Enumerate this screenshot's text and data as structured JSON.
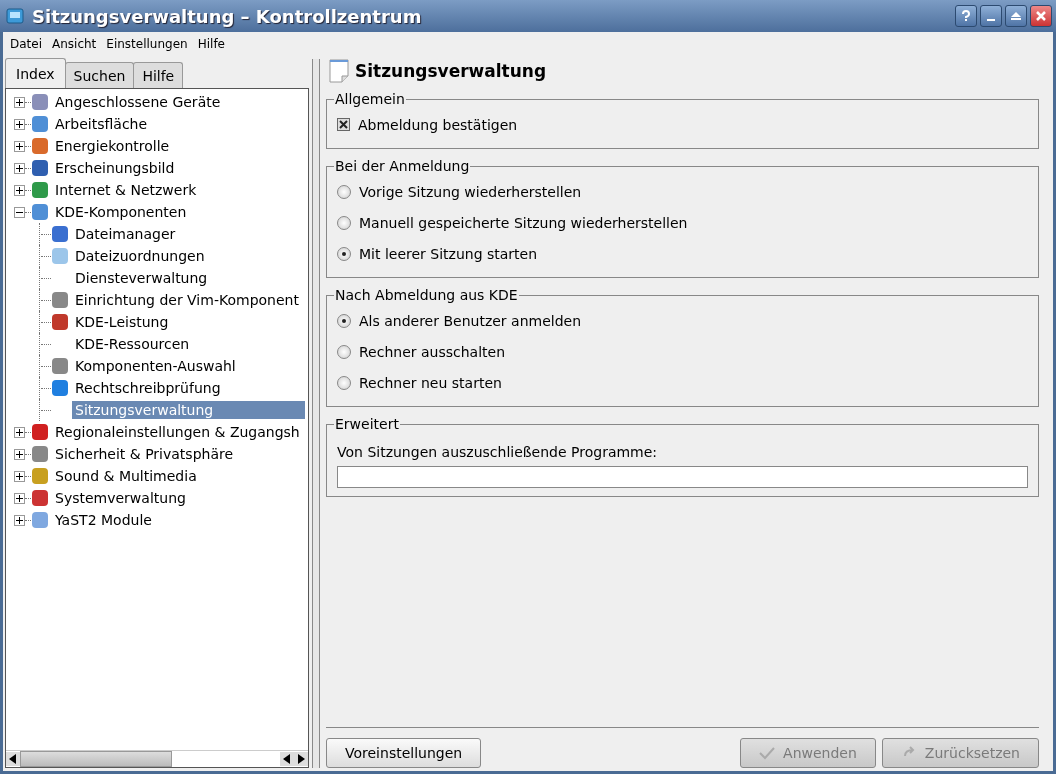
{
  "window": {
    "title": "Sitzungsverwaltung – Kontrollzentrum"
  },
  "menu": [
    "Datei",
    "Ansicht",
    "Einstellungen",
    "Hilfe"
  ],
  "tabs": [
    {
      "label": "Index",
      "selected": true
    },
    {
      "label": "Suchen",
      "selected": false
    },
    {
      "label": "Hilfe",
      "selected": false
    }
  ],
  "tree": [
    {
      "label": "Angeschlossene Geräte",
      "expanded": false,
      "selected": false,
      "has_icon": true
    },
    {
      "label": "Arbeitsfläche",
      "expanded": false,
      "selected": false,
      "has_icon": true
    },
    {
      "label": "Energiekontrolle",
      "expanded": false,
      "selected": false,
      "has_icon": true
    },
    {
      "label": "Erscheinungsbild",
      "expanded": false,
      "selected": false,
      "has_icon": true
    },
    {
      "label": "Internet & Netzwerk",
      "expanded": false,
      "selected": false,
      "has_icon": true
    },
    {
      "label": "KDE-Komponenten",
      "expanded": true,
      "selected": false,
      "has_icon": true,
      "children": [
        {
          "label": "Dateimanager",
          "selected": false,
          "has_icon": true
        },
        {
          "label": "Dateizuordnungen",
          "selected": false,
          "has_icon": true
        },
        {
          "label": "Diensteverwaltung",
          "selected": false,
          "has_icon": false
        },
        {
          "label": "Einrichtung der Vim-Komponent",
          "selected": false,
          "has_icon": true
        },
        {
          "label": "KDE-Leistung",
          "selected": false,
          "has_icon": true
        },
        {
          "label": "KDE-Ressourcen",
          "selected": false,
          "has_icon": false
        },
        {
          "label": "Komponenten-Auswahl",
          "selected": false,
          "has_icon": true
        },
        {
          "label": "Rechtschreibprüfung",
          "selected": false,
          "has_icon": true
        },
        {
          "label": "Sitzungsverwaltung",
          "selected": true,
          "has_icon": false
        }
      ]
    },
    {
      "label": "Regionaleinstellungen & Zugangsh",
      "expanded": false,
      "selected": false,
      "has_icon": true
    },
    {
      "label": "Sicherheit & Privatsphäre",
      "expanded": false,
      "selected": false,
      "has_icon": true
    },
    {
      "label": "Sound & Multimedia",
      "expanded": false,
      "selected": false,
      "has_icon": true
    },
    {
      "label": "Systemverwaltung",
      "expanded": false,
      "selected": false,
      "has_icon": true
    },
    {
      "label": "YaST2 Module",
      "expanded": false,
      "selected": false,
      "has_icon": true
    }
  ],
  "page_title": "Sitzungsverwaltung",
  "groups": [
    {
      "title": "Allgemein",
      "items": [
        {
          "kind": "checkbox",
          "label": "Abmeldung bestätigen",
          "checked": true
        }
      ]
    },
    {
      "title": "Bei der Anmeldung",
      "items": [
        {
          "kind": "radio",
          "label": "Vorige Sitzung wiederherstellen",
          "selected": false
        },
        {
          "kind": "radio",
          "label": "Manuell gespeicherte Sitzung wiederherstellen",
          "selected": false
        },
        {
          "kind": "radio",
          "label": "Mit leerer Sitzung starten",
          "selected": true
        }
      ]
    },
    {
      "title": "Nach Abmeldung aus KDE",
      "items": [
        {
          "kind": "radio",
          "label": "Als anderer Benutzer anmelden",
          "selected": true
        },
        {
          "kind": "radio",
          "label": "Rechner ausschalten",
          "selected": false
        },
        {
          "kind": "radio",
          "label": "Rechner neu starten",
          "selected": false
        }
      ]
    },
    {
      "title": "Erweitert",
      "items": [
        {
          "kind": "field",
          "label": "Von Sitzungen auszuschließende Programme:"
        }
      ]
    }
  ],
  "buttons": [
    {
      "label": "Voreinstellungen",
      "disabled": false
    },
    {
      "label": "Anwenden",
      "disabled": true
    },
    {
      "label": "Zurücksetzen",
      "disabled": true
    }
  ]
}
